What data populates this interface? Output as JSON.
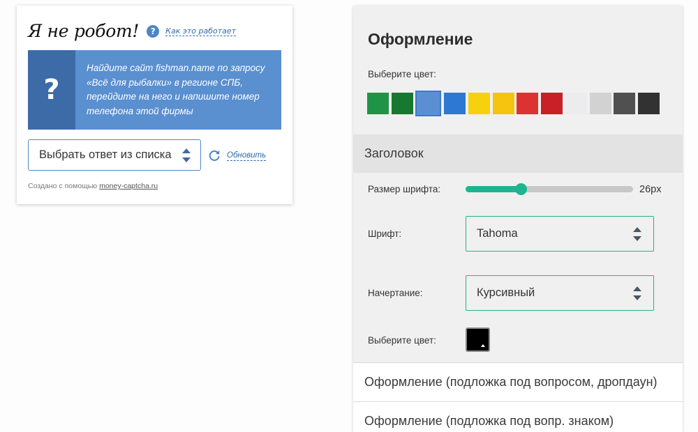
{
  "captcha": {
    "title": "Я не робот!",
    "help_symbol": "?",
    "how_link": "Как это работает",
    "question_symbol": "?",
    "question": "Найдите сайт fishman.name по запросу «Всё для рыбалки» в регионе СПБ, перейдите на него и напишите номер телефона этой фирмы",
    "select_value": "Выбрать ответ из списка",
    "refresh_label": "Обновить",
    "footer_prefix": "Создано с помощью",
    "footer_link": "money-captcha.ru",
    "colors": {
      "accent": "#5a8fd0",
      "accent_dark": "#3d6ba7",
      "link": "#2f6aa8"
    }
  },
  "panel": {
    "title": "Оформление",
    "choose_color_label": "Выберите цвет:",
    "swatches": [
      {
        "color": "#1f9447",
        "selected": false
      },
      {
        "color": "#17782f",
        "selected": false
      },
      {
        "color": "#5b8fd2",
        "selected": true
      },
      {
        "color": "#2d78d2",
        "selected": false
      },
      {
        "color": "#f5d10e",
        "selected": false
      },
      {
        "color": "#f6c30e",
        "selected": false
      },
      {
        "color": "#dd3232",
        "selected": false
      },
      {
        "color": "#c91f26",
        "selected": false
      },
      {
        "color": "#ececee",
        "selected": false
      },
      {
        "color": "#d2d2d2",
        "selected": false
      },
      {
        "color": "#505050",
        "selected": false
      },
      {
        "color": "#323232",
        "selected": false
      }
    ],
    "section_header": "Заголовок",
    "font_size_label": "Размер шрифта:",
    "font_size_value": "26px",
    "font_size_fraction": 0.33,
    "font_label": "Шрифт:",
    "font_value": "Tahoma",
    "style_label": "Начертание:",
    "style_value": "Курсивный",
    "color_label": "Выберите цвет:",
    "picked_color": "#000000",
    "accordion": [
      "Оформление (подложка под вопросом, дропдаун)",
      "Оформление (подложка под вопр. знаком)"
    ],
    "colors": {
      "accent": "#1fb48f",
      "track": "#c8c8c8"
    }
  }
}
